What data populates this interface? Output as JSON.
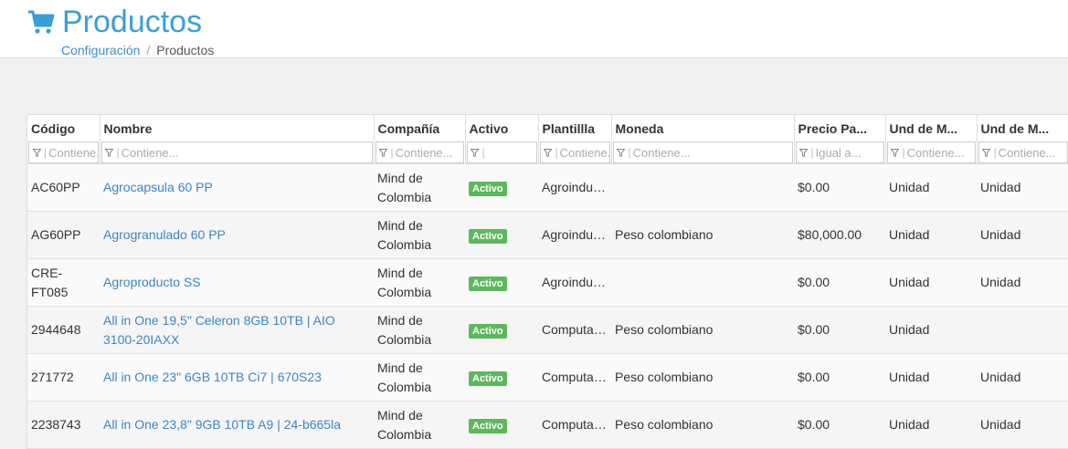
{
  "header": {
    "title": "Productos",
    "breadcrumb_parent": "Configuración",
    "breadcrumb_separator": "/",
    "breadcrumb_current": "Productos",
    "title_color": "#3a9fd6"
  },
  "table": {
    "columns": [
      {
        "label": "Código",
        "placeholder": "Contiene..."
      },
      {
        "label": "Nombre",
        "placeholder": "Contiene..."
      },
      {
        "label": "Compañía",
        "placeholder": "Contiene..."
      },
      {
        "label": "Activo",
        "placeholder": ""
      },
      {
        "label": "Plantillla",
        "placeholder": "Contiene..."
      },
      {
        "label": "Moneda",
        "placeholder": "Contiene..."
      },
      {
        "label": "Precio Pa...",
        "placeholder": "Igual a..."
      },
      {
        "label": "Und de M...",
        "placeholder": "Contiene..."
      },
      {
        "label": "Und de M...",
        "placeholder": "Contiene..."
      }
    ],
    "rows": [
      {
        "codigo": "AC60PP",
        "nombre": "Agrocapsula 60 PP",
        "compania": "Mind de Colombia",
        "activo": "Activo",
        "plantilla": "Agroindustria",
        "moneda": "",
        "precio": "$0.00",
        "und1": "Unidad",
        "und2": "Unidad"
      },
      {
        "codigo": "AG60PP",
        "nombre": "Agrogranulado 60 PP",
        "compania": "Mind de Colombia",
        "activo": "Activo",
        "plantilla": "Agroindustria",
        "moneda": "Peso colombiano",
        "precio": "$80,000.00",
        "und1": "Unidad",
        "und2": "Unidad"
      },
      {
        "codigo": "CRE-FT085",
        "nombre": "Agroproducto SS",
        "compania": "Mind de Colombia",
        "activo": "Activo",
        "plantilla": "Agroindustria",
        "moneda": "",
        "precio": "$0.00",
        "und1": "Unidad",
        "und2": "Unidad"
      },
      {
        "codigo": "2944648",
        "nombre": "All in One 19,5\" Celeron 8GB 10TB | AIO 3100-20IAXX",
        "compania": "Mind de Colombia",
        "activo": "Activo",
        "plantilla": "Computadores",
        "moneda": "Peso colombiano",
        "precio": "$0.00",
        "und1": "Unidad",
        "und2": ""
      },
      {
        "codigo": "271772",
        "nombre": "All in One 23\" 6GB 10TB Ci7 | 670S23",
        "compania": "Mind de Colombia",
        "activo": "Activo",
        "plantilla": "Computadores",
        "moneda": "Peso colombiano",
        "precio": "$0.00",
        "und1": "Unidad",
        "und2": "Unidad"
      },
      {
        "codigo": "2238743",
        "nombre": "All in One 23,8\" 9GB 10TB A9 | 24-b665la",
        "compania": "Mind de Colombia",
        "activo": "Activo",
        "plantilla": "Computadores",
        "moneda": "Peso colombiano",
        "precio": "$0.00",
        "und1": "Unidad",
        "und2": "Unidad"
      }
    ],
    "badge_color": "#5cb85c",
    "link_color": "#3a86c6"
  },
  "icons": {
    "cart": "shopping-cart-icon",
    "filter": "filter-icon"
  }
}
